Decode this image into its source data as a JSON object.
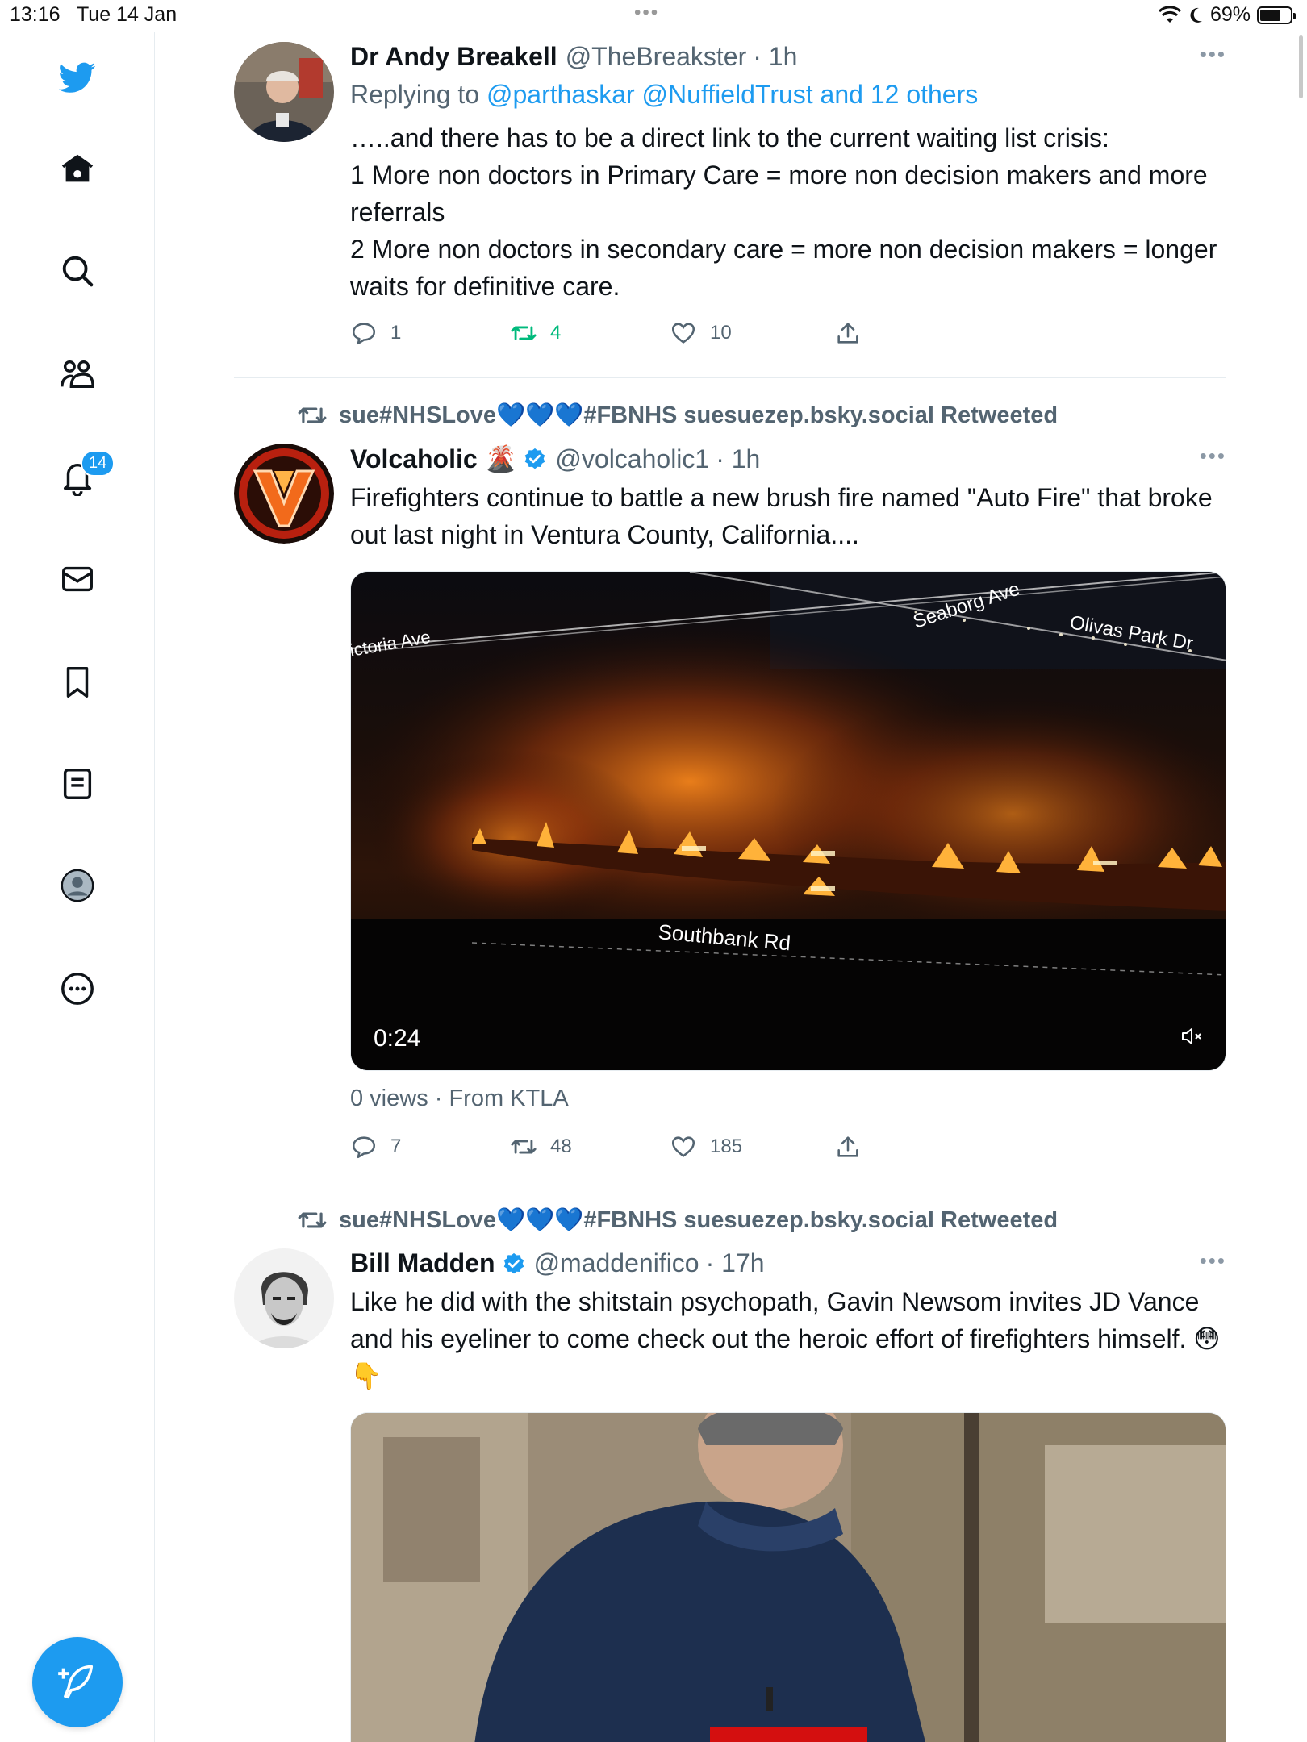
{
  "status_bar": {
    "time": "13:16",
    "date": "Tue 14 Jan",
    "battery_percent": "69%",
    "battery_level": 0.69,
    "icons": [
      "wifi-icon",
      "moon-icon",
      "battery-icon"
    ]
  },
  "sidebar": {
    "items": [
      {
        "name": "twitter-logo",
        "icon": "bird-icon"
      },
      {
        "name": "home",
        "icon": "home-icon"
      },
      {
        "name": "explore",
        "icon": "search-icon"
      },
      {
        "name": "communities",
        "icon": "people-icon"
      },
      {
        "name": "notifications",
        "icon": "bell-icon",
        "badge": "14"
      },
      {
        "name": "messages",
        "icon": "mail-icon"
      },
      {
        "name": "bookmarks",
        "icon": "bookmark-icon"
      },
      {
        "name": "lists",
        "icon": "list-icon"
      },
      {
        "name": "profile",
        "icon": "profile-icon"
      },
      {
        "name": "more",
        "icon": "more-icon"
      }
    ],
    "compose_icon": "compose-icon"
  },
  "colors": {
    "accent": "#1d9bf0",
    "retweet_green": "#00ba7c",
    "secondary_text": "#536471"
  },
  "tweets": [
    {
      "name": "Dr Andy Breakell",
      "handle": "@TheBreakster",
      "time": "· 1h",
      "replying_prefix": "Replying to",
      "replying_to": "@parthaskar @NuffieldTrust and 12 others",
      "lines": [
        "…..and there has to be a direct link to the current waiting list crisis:",
        "1 More non doctors in Primary Care = more non decision makers and more referrals",
        "2 More non doctors in secondary care = more non decision makers = longer waits for definitive care."
      ],
      "replies": "1",
      "retweets": "4",
      "likes": "10"
    },
    {
      "retweeted_by": "sue#NHSLove💙💙💙#FBNHS suesuezep.bsky.social Retweeted",
      "name": "Volcaholic 🌋",
      "handle": "@volcaholic1",
      "time": "· 1h",
      "text": "Firefighters continue to battle a new brush fire named \"Auto Fire\" that broke out last night in Ventura County, California....",
      "video": {
        "duration": "0:24",
        "map_labels": {
          "road1": "ictoria Ave",
          "road2": "Seaborg Ave",
          "road3": "Olivas Park Dr",
          "road4": "Southbank Rd"
        }
      },
      "meta": "0 views · From KTLA",
      "replies": "7",
      "retweets": "48",
      "likes": "185"
    },
    {
      "retweeted_by": "sue#NHSLove💙💙💙#FBNHS suesuezep.bsky.social Retweeted",
      "name": "Bill Madden",
      "handle": "@maddenifico",
      "time": "· 17h",
      "text": "Like he did with the shitstain psychopath, Gavin Newsom invites JD Vance and his eyeliner to come check out the heroic effort of firefighters himself. 😳 👇"
    }
  ]
}
